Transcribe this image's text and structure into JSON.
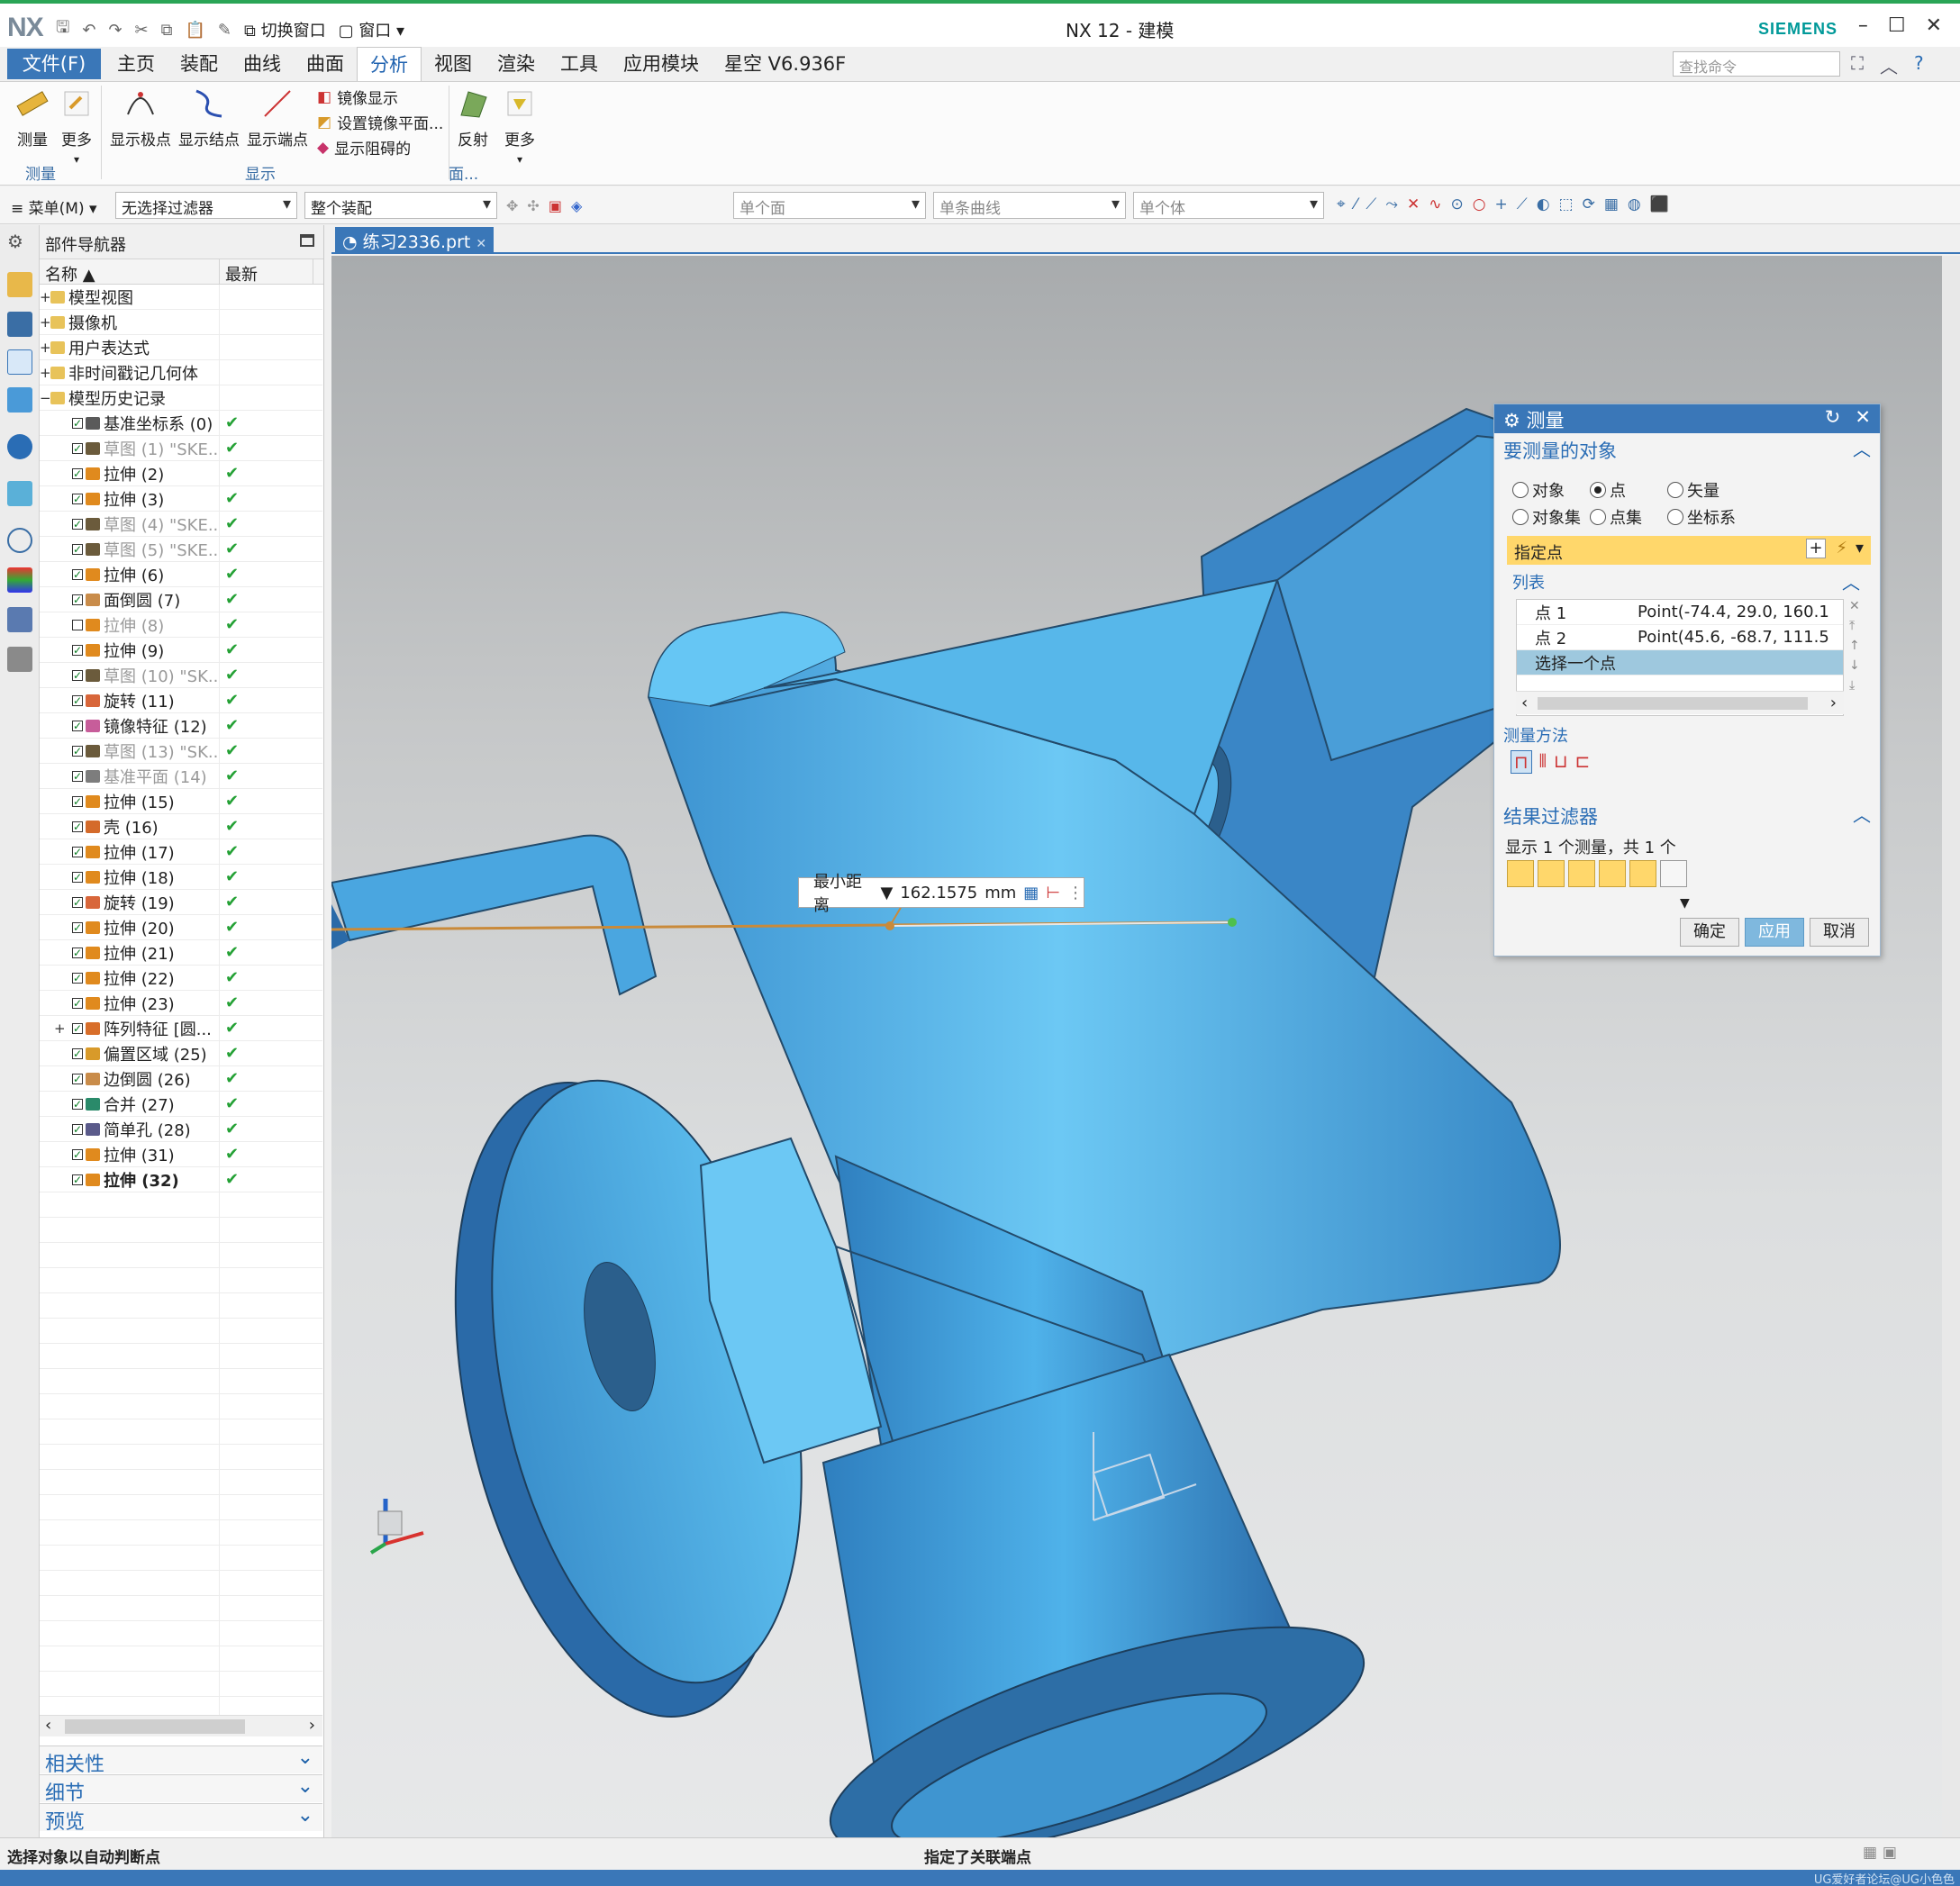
{
  "titlebar": {
    "logo": "NX",
    "switch_window": "切换窗口",
    "window_menu": "窗口",
    "title": "NX 12 - 建模",
    "brand": "SIEMENS"
  },
  "menubar": {
    "file": "文件(F)",
    "tabs": [
      "主页",
      "装配",
      "曲线",
      "曲面",
      "分析",
      "视图",
      "渲染",
      "工具",
      "应用模块",
      "星空 V6.936F"
    ],
    "active_tab": "分析",
    "search_placeholder": "查找命令"
  },
  "ribbon": {
    "measure": "测量",
    "more1": "更多",
    "show_poles": "显示极点",
    "show_knots": "显示结点",
    "show_endpoints": "显示端点",
    "mirror_display": "镜像显示",
    "set_mirror_plane": "设置镜像平面...",
    "show_obstruct": "显示阻碍的",
    "reflect": "反射",
    "more2": "更多",
    "group_measure": "测量",
    "group_display": "显示",
    "group_face": "面..."
  },
  "selbar": {
    "menu": "菜单(M)",
    "filter": "无选择过滤器",
    "scope": "整个装配",
    "face_rule": "单个面",
    "curve_rule": "单条曲线",
    "body_rule": "单个体"
  },
  "partnav": {
    "title": "部件导航器",
    "col_name": "名称",
    "col_latest": "最新",
    "groups": [
      {
        "label": "模型视图",
        "exp": "+"
      },
      {
        "label": "摄像机",
        "exp": "+"
      },
      {
        "label": "用户表达式",
        "exp": "+"
      },
      {
        "label": "非时间戳记几何体",
        "exp": "+"
      },
      {
        "label": "模型历史记录",
        "exp": "−"
      }
    ],
    "features": [
      {
        "label": "基准坐标系 (0)",
        "dim": false,
        "color": "#5a5a5a"
      },
      {
        "label": "草图 (1) \"SKE...",
        "dim": true,
        "color": "#6b5b3c"
      },
      {
        "label": "拉伸 (2)",
        "dim": false,
        "color": "#e08a1e"
      },
      {
        "label": "拉伸 (3)",
        "dim": false,
        "color": "#e08a1e"
      },
      {
        "label": "草图 (4) \"SKE...",
        "dim": true,
        "color": "#6b5b3c"
      },
      {
        "label": "草图 (5) \"SKE...",
        "dim": true,
        "color": "#6b5b3c"
      },
      {
        "label": "拉伸 (6)",
        "dim": false,
        "color": "#e08a1e"
      },
      {
        "label": "面倒圆 (7)",
        "dim": false,
        "color": "#c98c4a"
      },
      {
        "label": "拉伸 (8)",
        "dim": true,
        "color": "#e08a1e"
      },
      {
        "label": "拉伸 (9)",
        "dim": false,
        "color": "#e08a1e"
      },
      {
        "label": "草图 (10) \"SK...",
        "dim": true,
        "color": "#6b5b3c"
      },
      {
        "label": "旋转 (11)",
        "dim": false,
        "color": "#d8663a"
      },
      {
        "label": "镜像特征 (12)",
        "dim": false,
        "color": "#c75d9a"
      },
      {
        "label": "草图 (13) \"SK...",
        "dim": true,
        "color": "#6b5b3c"
      },
      {
        "label": "基准平面 (14)",
        "dim": true,
        "color": "#7d7d7d"
      },
      {
        "label": "拉伸 (15)",
        "dim": false,
        "color": "#e08a1e"
      },
      {
        "label": "壳 (16)",
        "dim": false,
        "color": "#d46a2a"
      },
      {
        "label": "拉伸 (17)",
        "dim": false,
        "color": "#e08a1e"
      },
      {
        "label": "拉伸 (18)",
        "dim": false,
        "color": "#e08a1e"
      },
      {
        "label": "旋转 (19)",
        "dim": false,
        "color": "#d8663a"
      },
      {
        "label": "拉伸 (20)",
        "dim": false,
        "color": "#e08a1e"
      },
      {
        "label": "拉伸 (21)",
        "dim": false,
        "color": "#e08a1e"
      },
      {
        "label": "拉伸 (22)",
        "dim": false,
        "color": "#e08a1e"
      },
      {
        "label": "拉伸 (23)",
        "dim": false,
        "color": "#e08a1e"
      },
      {
        "label": "阵列特征 [圆...",
        "dim": false,
        "color": "#d86e2a",
        "exp": "+"
      },
      {
        "label": "偏置区域 (25)",
        "dim": false,
        "color": "#d89a2a"
      },
      {
        "label": "边倒圆 (26)",
        "dim": false,
        "color": "#c98c4a"
      },
      {
        "label": "合并 (27)",
        "dim": false,
        "color": "#2a8a6a"
      },
      {
        "label": "简单孔 (28)",
        "dim": false,
        "color": "#5a5a8a"
      },
      {
        "label": "拉伸 (31)",
        "dim": false,
        "color": "#e08a1e"
      },
      {
        "label": "拉伸 (32)",
        "dim": false,
        "color": "#e08a1e",
        "bold": true
      }
    ],
    "panels": [
      "相关性",
      "细节",
      "预览"
    ]
  },
  "doc_tab": "练习2336.prt",
  "callout": {
    "label": "最小距离",
    "value": "162.1575",
    "unit": "mm"
  },
  "measure": {
    "title": "测量",
    "sec_objects": "要测量的对象",
    "radio_object": "对象",
    "radio_point": "点",
    "radio_vector": "矢量",
    "radio_objset": "对象集",
    "radio_pointset": "点集",
    "radio_csys": "坐标系",
    "selected_radio": "点",
    "specify": "指定点",
    "list_title": "列表",
    "rows": [
      {
        "name": "点 1",
        "value": "Point(-74.4, 29.0, 160.1"
      },
      {
        "name": "点 2",
        "value": "Point(45.6, -68.7, 111.5"
      },
      {
        "name": "选择一个点",
        "value": ""
      }
    ],
    "method_title": "测量方法",
    "sec_filter": "结果过滤器",
    "filter_text": "显示 1 个测量，共 1 个",
    "ok": "确定",
    "apply": "应用",
    "cancel": "取消"
  },
  "status": {
    "left": "选择对象以自动判断点",
    "center": "指定了关联端点"
  },
  "colors": {
    "accent": "#3a77b8",
    "model": "#4aa6e0",
    "highlight": "#ffd76b",
    "check": "#24a135"
  },
  "watermark": "UG爱好者论坛@UG小色色"
}
